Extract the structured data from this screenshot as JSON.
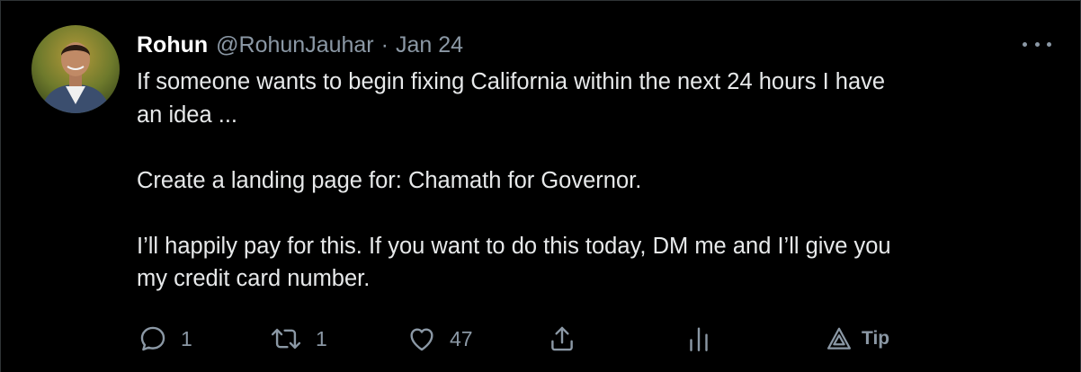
{
  "tweet": {
    "author_name": "Rohun",
    "author_handle": "@RohunJauhar",
    "separator": "·",
    "date": "Jan 24",
    "lines": [
      "If someone wants to begin fixing California within the next 24 hours I have",
      "an idea ...",
      "",
      "Create a landing page for: Chamath for Governor.",
      "",
      "I’ll happily pay for this. If you want to do this today, DM me and I’ll give you",
      "my credit card number."
    ]
  },
  "actions": {
    "reply_count": "1",
    "retweet_count": "1",
    "like_count": "47",
    "tip_label": "Tip"
  },
  "icons": {
    "avatar": "avatar",
    "more": "more-icon",
    "reply": "reply-icon",
    "retweet": "retweet-icon",
    "like": "heart-icon",
    "share": "share-icon",
    "analytics": "analytics-icon",
    "tip": "tip-icon"
  },
  "colors": {
    "background": "#000000",
    "text": "#e7e9ea",
    "secondary": "#8b98a5",
    "border": "#2f3336"
  }
}
